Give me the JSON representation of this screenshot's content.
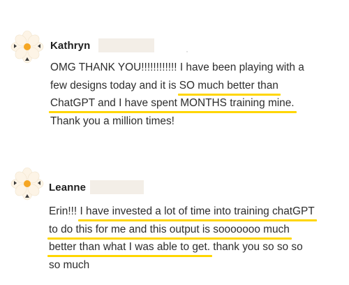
{
  "comments": [
    {
      "author": "Kathryn",
      "lines": [
        {
          "parts": [
            {
              "text": "OMG THANK YOU!!!!!!!!!!!! I have been playing with a",
              "hl": false
            }
          ]
        },
        {
          "parts": [
            {
              "text": "few designs today and it is ",
              "hl": false
            },
            {
              "text": "SO much better than",
              "hl": true
            }
          ]
        },
        {
          "parts": [
            {
              "text": "ChatGPT and I have spent MONTHS training mine.",
              "hl": true
            }
          ]
        },
        {
          "parts": [
            {
              "text": "Thank you a million times!",
              "hl": false
            }
          ]
        }
      ]
    },
    {
      "author": "Leanne",
      "lines": [
        {
          "parts": [
            {
              "text": "Erin!!! ",
              "hl": false
            },
            {
              "text": "I have invested a lot of time into training chatGPT",
              "hl": true
            }
          ]
        },
        {
          "parts": [
            {
              "text": "to do this for me and this output is sooooooo much",
              "hl": true
            }
          ]
        },
        {
          "parts": [
            {
              "text": "better than what I was able to get.",
              "hl": true
            },
            {
              "text": " thank you so so so",
              "hl": false
            }
          ]
        },
        {
          "parts": [
            {
              "text": "so much",
              "hl": false
            }
          ]
        }
      ]
    }
  ],
  "colors": {
    "highlight": "#ffd600",
    "avatar_petal": "#fdf4e6",
    "avatar_center": "#f5a623",
    "avatar_points": "#3a3a3a",
    "redaction": "#f3eee7"
  },
  "icons": {
    "avatar": "flower-avatar-icon"
  }
}
